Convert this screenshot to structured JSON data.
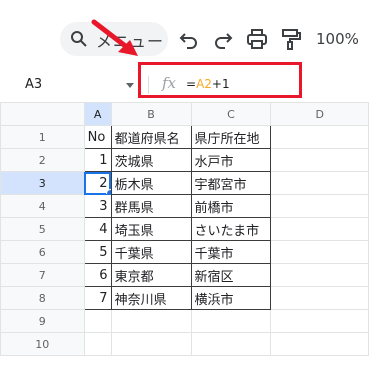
{
  "toolbar": {
    "menu_label": "メニュー",
    "zoom": "100%",
    "icons": [
      "search-icon",
      "undo-icon",
      "redo-icon",
      "print-icon",
      "paint-format-icon"
    ]
  },
  "formula_bar": {
    "cell_ref": "A3",
    "fx": "fx",
    "formula_eq": "=",
    "formula_ref": "A2",
    "formula_rest": "+1"
  },
  "colors": {
    "accent": "#1a73e8",
    "highlight": "#e8172a",
    "ref": "#f9a825"
  },
  "columns": [
    "A",
    "B",
    "C",
    "D"
  ],
  "rows": [
    {
      "n": "1",
      "a": "No",
      "b": "都道府県名",
      "c": "県庁所在地"
    },
    {
      "n": "2",
      "a": "1",
      "b": "茨城県",
      "c": "水戸市"
    },
    {
      "n": "3",
      "a": "2",
      "b": "栃木県",
      "c": "宇都宮市"
    },
    {
      "n": "4",
      "a": "3",
      "b": "群馬県",
      "c": "前橋市"
    },
    {
      "n": "5",
      "a": "4",
      "b": "埼玉県",
      "c": "さいたま市"
    },
    {
      "n": "6",
      "a": "5",
      "b": "千葉県",
      "c": "千葉市"
    },
    {
      "n": "7",
      "a": "6",
      "b": "東京都",
      "c": "新宿区"
    },
    {
      "n": "8",
      "a": "7",
      "b": "神奈川県",
      "c": "横浜市"
    },
    {
      "n": "9",
      "a": "",
      "b": "",
      "c": ""
    },
    {
      "n": "10",
      "a": "",
      "b": "",
      "c": ""
    }
  ]
}
